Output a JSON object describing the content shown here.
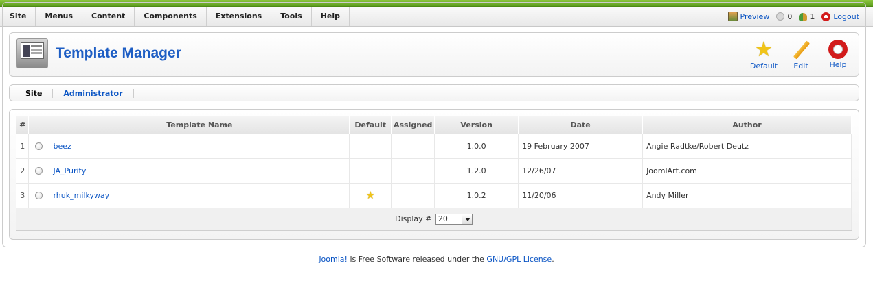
{
  "menu": [
    "Site",
    "Menus",
    "Content",
    "Components",
    "Extensions",
    "Tools",
    "Help"
  ],
  "status": {
    "preview": "Preview",
    "messages": "0",
    "users": "1",
    "logout": "Logout"
  },
  "header": {
    "title": "Template Manager"
  },
  "toolbar": {
    "default": "Default",
    "edit": "Edit",
    "help": "Help"
  },
  "tabs": [
    "Site",
    "Administrator"
  ],
  "table": {
    "headers": [
      "#",
      "Template Name",
      "Default",
      "Assigned",
      "Version",
      "Date",
      "Author"
    ],
    "rows": [
      {
        "num": "1",
        "name": "beez",
        "default": false,
        "version": "1.0.0",
        "date": "19 February 2007",
        "author": "Angie Radtke/Robert Deutz"
      },
      {
        "num": "2",
        "name": "JA_Purity",
        "default": false,
        "version": "1.2.0",
        "date": "12/26/07",
        "author": "JoomlArt.com"
      },
      {
        "num": "3",
        "name": "rhuk_milkyway",
        "default": true,
        "version": "1.0.2",
        "date": "11/20/06",
        "author": "Andy Miller"
      }
    ],
    "display_label": "Display #",
    "display_value": "20"
  },
  "footer": {
    "joomla": "Joomla!",
    "middle": " is Free Software released under the ",
    "license": "GNU/GPL License",
    "end": "."
  },
  "colors": {
    "accent": "#0b55c4",
    "topbar": "#6fae2a",
    "star": "#f0c419",
    "help": "#d21b1b"
  }
}
